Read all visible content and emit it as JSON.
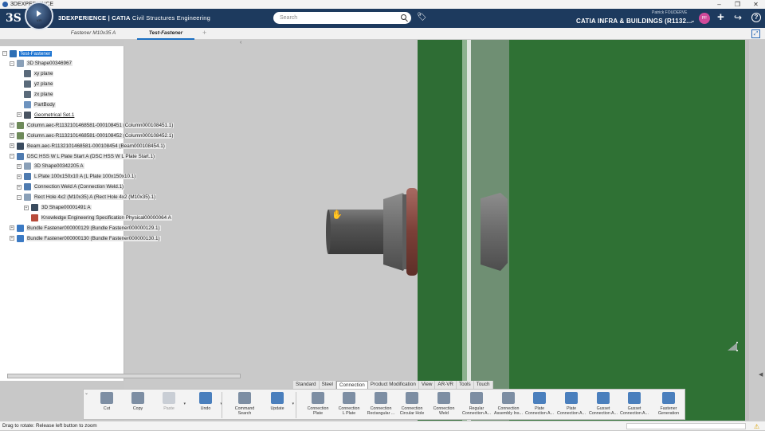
{
  "window": {
    "title": "3DEXPERIENCE",
    "controls": [
      "–",
      "❐",
      "✕"
    ]
  },
  "header": {
    "logo": "3S",
    "compass_label": "V.R",
    "brand_strong": "3DEXPERIENCE | CATIA",
    "brand_rest": " Civil Structures Engineering",
    "search_placeholder": "Search",
    "user_name": "Patrick FOUDERVE",
    "app_title": "CATIA INFRA & BUILDINGS (R1132...",
    "avatar_initials": "PF"
  },
  "tabs": [
    {
      "label": "Fastener M10x35 A",
      "active": false
    },
    {
      "label": "Test-Fastener",
      "active": true
    }
  ],
  "tree": [
    {
      "label": "Test-Fastener",
      "style": "sel",
      "icon": "root"
    },
    {
      "label": "3D Shape00346967",
      "style": "hl",
      "icon": "shape"
    },
    {
      "label": "xy plane",
      "style": "hl",
      "icon": "plane"
    },
    {
      "label": "yz plane",
      "style": "hl",
      "icon": "plane"
    },
    {
      "label": "zx plane",
      "style": "hl",
      "icon": "plane"
    },
    {
      "label": "PartBody",
      "style": "hl",
      "icon": "body"
    },
    {
      "label": "Geometrical Set.1",
      "style": "ul",
      "icon": "geom"
    },
    {
      "label": "Column.aec-R1132101468581-000108451 (Column000108451.1)",
      "style": "hl",
      "icon": "col"
    },
    {
      "label": "Column.aec-R1132101468581-000108452 (Column000108452.1)",
      "style": "hl",
      "icon": "col"
    },
    {
      "label": "Beam.aec-R1132101468581-000108454 (Beam000108454.1)",
      "style": "hl",
      "icon": "beam"
    },
    {
      "label": "DSC HSS W L Plate Start A (DSC HSS W L Plate Start.1)",
      "style": "hl",
      "icon": "conn"
    },
    {
      "label": "3D Shape00342205 A",
      "style": "hl",
      "icon": "shape"
    },
    {
      "label": "L Plate 100x150x10 A (L Plate 100x150x10.1)",
      "style": "hl",
      "icon": "conn"
    },
    {
      "label": "Connection Weld A (Connection Weld.1)",
      "style": "hl",
      "icon": "conn"
    },
    {
      "label": "Rect Hole 4x2 (M10x35) A (Rect Hole 4x2 (M10x35).1)",
      "style": "hl",
      "icon": "shape"
    },
    {
      "label": "3D Shape00001491 A",
      "style": "hl",
      "icon": "beam"
    },
    {
      "label": "Knowledge Engineering Specification Physical00000064 A",
      "style": "hl",
      "icon": "ke"
    },
    {
      "label": "Bundle Fastener000000129 (Bundle Fastener000000129.1)",
      "style": "hl",
      "icon": "bundle"
    },
    {
      "label": "Bundle Fastener000000130 (Bundle Fastener000000130.1)",
      "style": "hl",
      "icon": "bundle"
    }
  ],
  "command_tabs": [
    "Standard",
    "Steel",
    "Connection",
    "Product Modification",
    "View",
    "AR-VR",
    "Tools",
    "Touch"
  ],
  "active_command_tab": "Connection",
  "actions": [
    {
      "label1": "Cut",
      "label2": "",
      "icon": "scissors-icon"
    },
    {
      "label1": "Copy",
      "label2": "",
      "icon": "copy-icon"
    },
    {
      "label1": "Paste",
      "label2": "",
      "icon": "paste-icon",
      "disabled": true
    },
    {
      "label1": "Undo",
      "label2": "",
      "icon": "undo-icon"
    },
    {
      "label1": "Command",
      "label2": "Search",
      "icon": "command-search-icon"
    },
    {
      "label1": "Update",
      "label2": "",
      "icon": "update-icon"
    },
    {
      "label1": "Connection",
      "label2": "Plate",
      "icon": "connection-plate-icon"
    },
    {
      "label1": "Connection",
      "label2": "L Plate",
      "icon": "connection-l-plate-icon"
    },
    {
      "label1": "Connection",
      "label2": "Rectangular ...",
      "icon": "connection-rectangular-icon"
    },
    {
      "label1": "Connection",
      "label2": "Circular Hole",
      "icon": "connection-circular-hole-icon"
    },
    {
      "label1": "Connection",
      "label2": "Weld",
      "icon": "connection-weld-icon"
    },
    {
      "label1": "Regular",
      "label2": "Connection A...",
      "icon": "regular-connection-icon"
    },
    {
      "label1": "Connection",
      "label2": "Assembly Ins...",
      "icon": "connection-assembly-icon"
    },
    {
      "label1": "Plate",
      "label2": "Connection A...",
      "icon": "plate-connection-icon"
    },
    {
      "label1": "Plate",
      "label2": "Connection A...",
      "icon": "plate-connection-2-icon"
    },
    {
      "label1": "Gusset",
      "label2": "Connection A...",
      "icon": "gusset-connection-icon"
    },
    {
      "label1": "Gusset",
      "label2": "Connection A...",
      "icon": "gusset-connection-2-icon"
    },
    {
      "label1": "Fastener",
      "label2": "Generation",
      "icon": "fastener-generation-icon"
    }
  ],
  "status": {
    "message": "Drag to rotate: Release left button to zoom"
  }
}
